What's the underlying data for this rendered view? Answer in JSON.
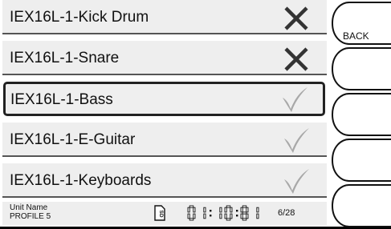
{
  "channels": [
    {
      "label": "IEX16L-1-Kick Drum",
      "status": "inactive",
      "status_icon": "x-mark-icon",
      "selected": false
    },
    {
      "label": "IEX16L-1-Snare",
      "status": "inactive",
      "status_icon": "x-mark-icon",
      "selected": false
    },
    {
      "label": "IEX16L-1-Bass",
      "status": "active",
      "status_icon": "check-mark-icon",
      "selected": true
    },
    {
      "label": "IEX16L-1-E-Guitar",
      "status": "active",
      "status_icon": "check-mark-icon",
      "selected": false
    },
    {
      "label": "IEX16L-1-Keyboards",
      "status": "active",
      "status_icon": "check-mark-icon",
      "selected": false
    }
  ],
  "status_bar": {
    "unit_name_label": "Unit Name",
    "profile": "PROFILE 5",
    "sd_label": "SD",
    "counter": "01:10:81",
    "page": "6/28"
  },
  "side_buttons": {
    "back_label": "BACK"
  },
  "colors": {
    "x_mark": "#333333",
    "check_mark": "#a8a8a8",
    "row_bg": "#eeeeee"
  }
}
